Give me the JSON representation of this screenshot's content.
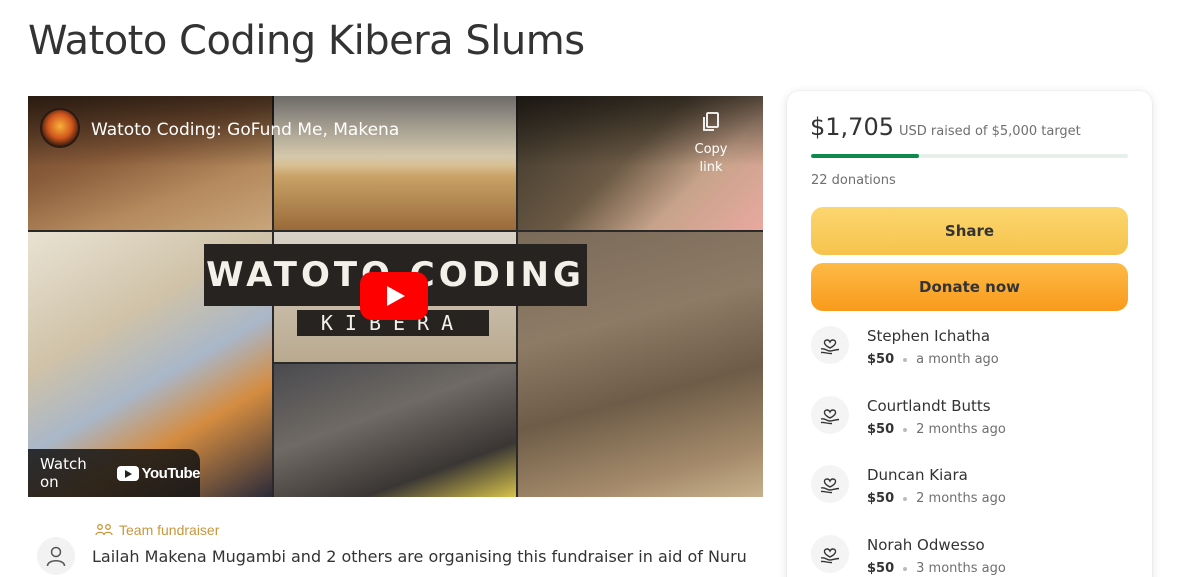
{
  "page": {
    "title": "Watoto Coding Kibera Slums"
  },
  "video": {
    "title": "Watoto Coding: GoFund Me, Makena",
    "copy_link_label": "Copy link",
    "banner_title": "WATOTO CODING",
    "banner_subtitle": "KIBERA",
    "watch_on_label": "Watch on",
    "youtube_label": "YouTube"
  },
  "organizer": {
    "team_label": "Team fundraiser",
    "description": "Lailah Makena Mugambi and 2 others are organising this fundraiser in aid of Nuru"
  },
  "donation_card": {
    "amount_raised": "$1,705",
    "target_text": "USD raised of $5,000 target",
    "progress_fraction": 0.341,
    "donation_count": "22 donations",
    "share_label": "Share",
    "donate_label": "Donate now",
    "accent_color": "#0f8a4d",
    "donors": [
      {
        "name": "Stephen Ichatha",
        "amount": "$50",
        "time": "a month ago"
      },
      {
        "name": "Courtlandt Butts",
        "amount": "$50",
        "time": "2 months ago"
      },
      {
        "name": "Duncan Kiara",
        "amount": "$50",
        "time": "2 months ago"
      },
      {
        "name": "Norah Odwesso",
        "amount": "$50",
        "time": "3 months ago"
      }
    ]
  }
}
